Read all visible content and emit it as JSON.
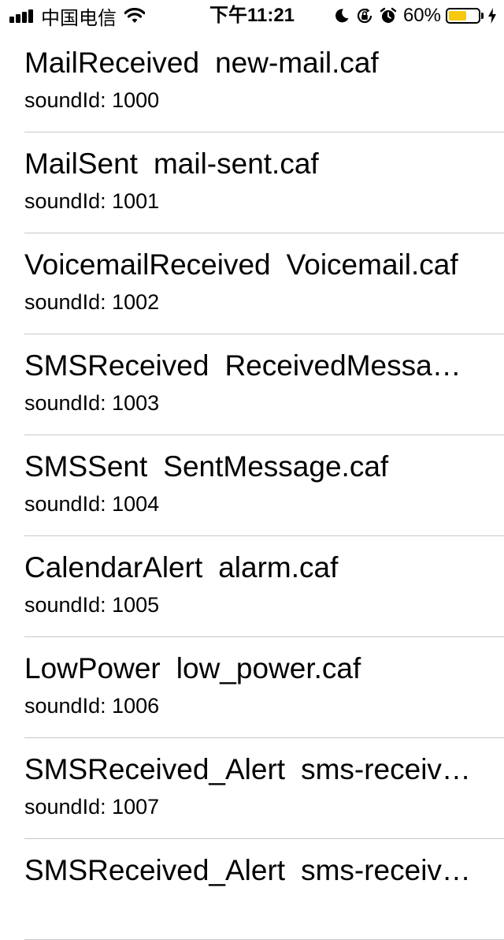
{
  "status_bar": {
    "carrier": "中国电信",
    "time": "下午11:21",
    "battery_percent_text": "60%",
    "battery_level": 0.6,
    "battery_color": "#f6c90e"
  },
  "sounds": [
    {
      "name": "MailReceived",
      "file": "new-mail.caf",
      "subtitle": "soundId: 1000"
    },
    {
      "name": "MailSent",
      "file": "mail-sent.caf",
      "subtitle": "soundId: 1001"
    },
    {
      "name": "VoicemailReceived",
      "file": "Voicemail.caf",
      "subtitle": "soundId: 1002"
    },
    {
      "name": "SMSReceived",
      "file": "ReceivedMessag…",
      "subtitle": "soundId: 1003"
    },
    {
      "name": "SMSSent",
      "file": "SentMessage.caf",
      "subtitle": "soundId: 1004"
    },
    {
      "name": "CalendarAlert",
      "file": "alarm.caf",
      "subtitle": "soundId: 1005"
    },
    {
      "name": "LowPower",
      "file": "low_power.caf",
      "subtitle": "soundId: 1006"
    },
    {
      "name": "SMSReceived_Alert",
      "file": "sms-receiv…",
      "subtitle": "soundId: 1007"
    },
    {
      "name": "SMSReceived_Alert",
      "file": "sms-receiv…",
      "subtitle": ""
    }
  ]
}
